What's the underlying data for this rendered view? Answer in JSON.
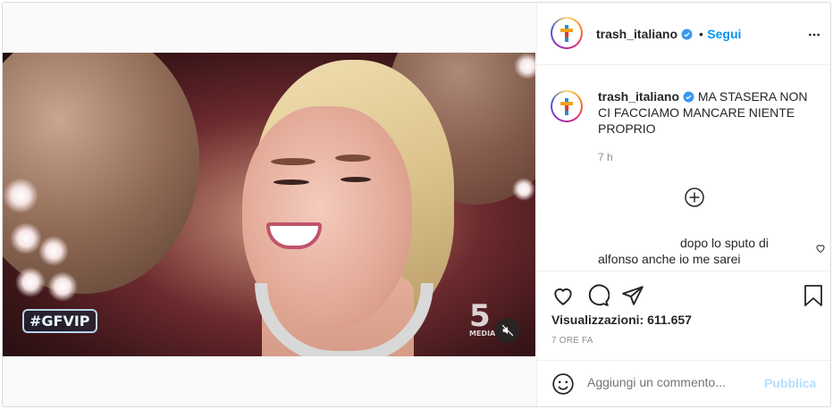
{
  "header": {
    "username": "trash_italiano",
    "verified": true,
    "separator": "•",
    "follow_label": "Segui",
    "more_label": "..."
  },
  "video": {
    "overlay_tag": "#GFVIP",
    "channel_number": "5",
    "channel_sub": "MEDIA",
    "muted": true
  },
  "caption": {
    "username": "trash_italiano",
    "text": "MA STASERA NON CI FACCIAMO MANCARE NIENTE PROPRIO",
    "time": "7 h"
  },
  "comments": [
    {
      "text": "dopo lo sputo di alfonso anche io me sarei"
    }
  ],
  "stats": {
    "views": "Visualizzazioni: 611.657",
    "posted_ago": "7 ORE FA"
  },
  "add_comment": {
    "placeholder": "Aggiungi un commento...",
    "publish_label": "Pubblica"
  },
  "colors": {
    "accent": "#0095f6",
    "publish_disabled": "#b2dffc",
    "border": "#dbdbdb",
    "muted_text": "#8e8e8e"
  },
  "icons": [
    "verified-badge-icon",
    "more-icon",
    "load-more-icon",
    "heart-icon",
    "comment-icon",
    "share-icon",
    "bookmark-icon",
    "emoji-icon",
    "mute-icon"
  ]
}
